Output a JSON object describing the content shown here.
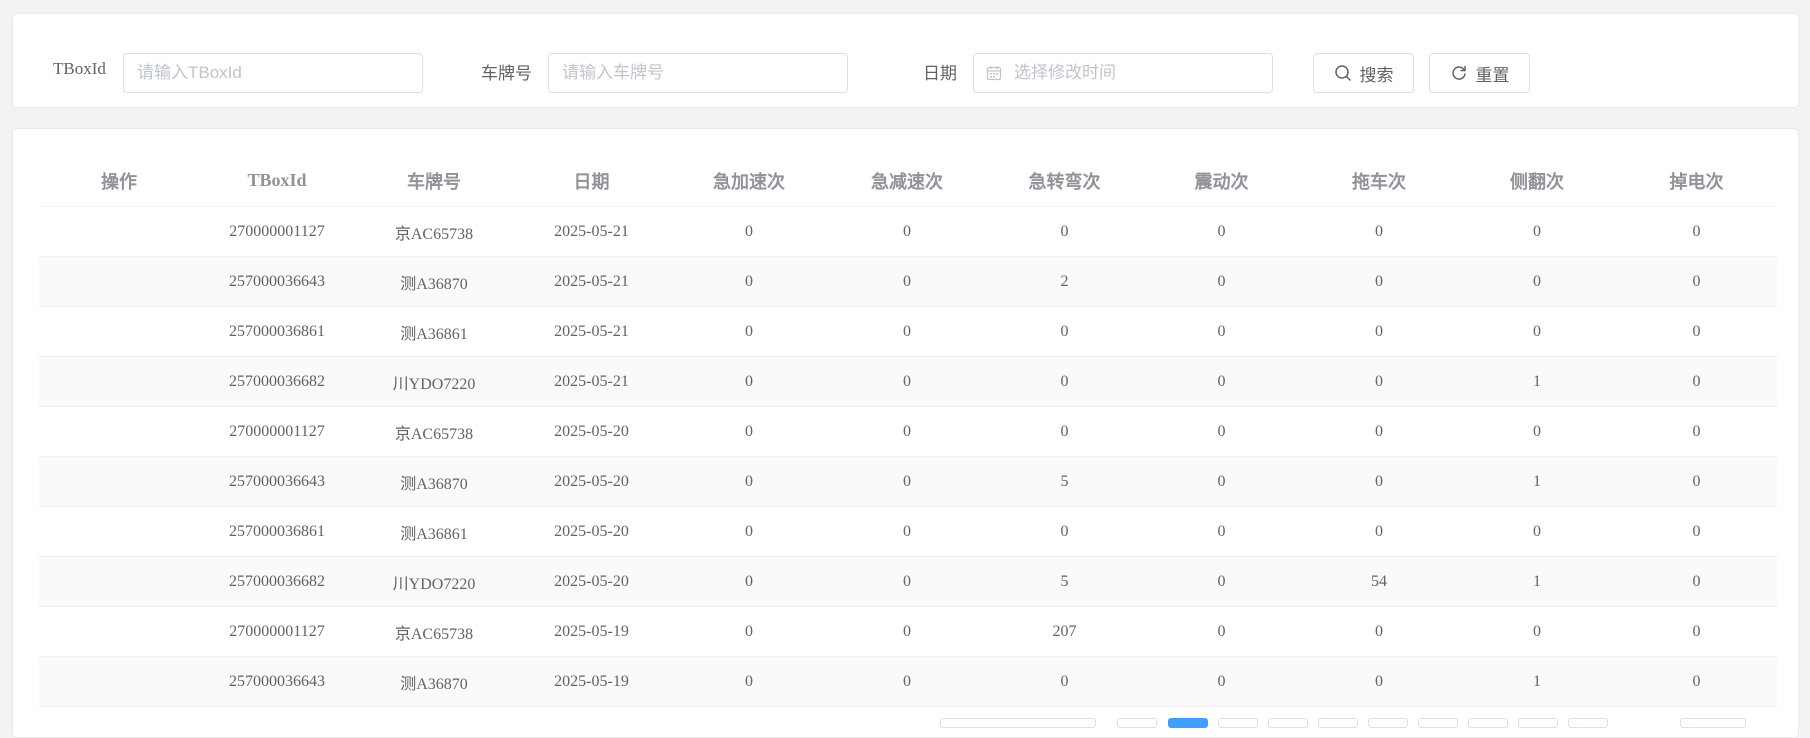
{
  "search": {
    "tboxid_label": "TBoxId",
    "tboxid_placeholder": "请输入TBoxId",
    "plate_label": "车牌号",
    "plate_placeholder": "请输入车牌号",
    "date_label": "日期",
    "date_placeholder": "选择修改时间",
    "search_button": "搜索",
    "reset_button": "重置"
  },
  "table": {
    "columns": [
      "操作",
      "TBoxId",
      "车牌号",
      "日期",
      "急加速次",
      "急减速次",
      "急转弯次",
      "震动次",
      "拖车次",
      "侧翻次",
      "掉电次"
    ],
    "rows": [
      [
        "",
        "270000001127",
        "京AC65738",
        "2025-05-21",
        "0",
        "0",
        "0",
        "0",
        "0",
        "0",
        "0"
      ],
      [
        "",
        "257000036643",
        "测A36870",
        "2025-05-21",
        "0",
        "0",
        "2",
        "0",
        "0",
        "0",
        "0"
      ],
      [
        "",
        "257000036861",
        "测A36861",
        "2025-05-21",
        "0",
        "0",
        "0",
        "0",
        "0",
        "0",
        "0"
      ],
      [
        "",
        "257000036682",
        "川YDO7220",
        "2025-05-21",
        "0",
        "0",
        "0",
        "0",
        "0",
        "1",
        "0"
      ],
      [
        "",
        "270000001127",
        "京AC65738",
        "2025-05-20",
        "0",
        "0",
        "0",
        "0",
        "0",
        "0",
        "0"
      ],
      [
        "",
        "257000036643",
        "测A36870",
        "2025-05-20",
        "0",
        "0",
        "5",
        "0",
        "0",
        "1",
        "0"
      ],
      [
        "",
        "257000036861",
        "测A36861",
        "2025-05-20",
        "0",
        "0",
        "0",
        "0",
        "0",
        "0",
        "0"
      ],
      [
        "",
        "257000036682",
        "川YDO7220",
        "2025-05-20",
        "0",
        "0",
        "5",
        "0",
        "54",
        "1",
        "0"
      ],
      [
        "",
        "270000001127",
        "京AC65738",
        "2025-05-19",
        "0",
        "0",
        "207",
        "0",
        "0",
        "0",
        "0"
      ],
      [
        "",
        "257000036643",
        "测A36870",
        "2025-05-19",
        "0",
        "0",
        "0",
        "0",
        "0",
        "1",
        "0"
      ]
    ]
  },
  "colors": {
    "accent": "#409eff",
    "header_text": "#909399",
    "cell_text": "#606266",
    "stripe": "#fafafa"
  }
}
